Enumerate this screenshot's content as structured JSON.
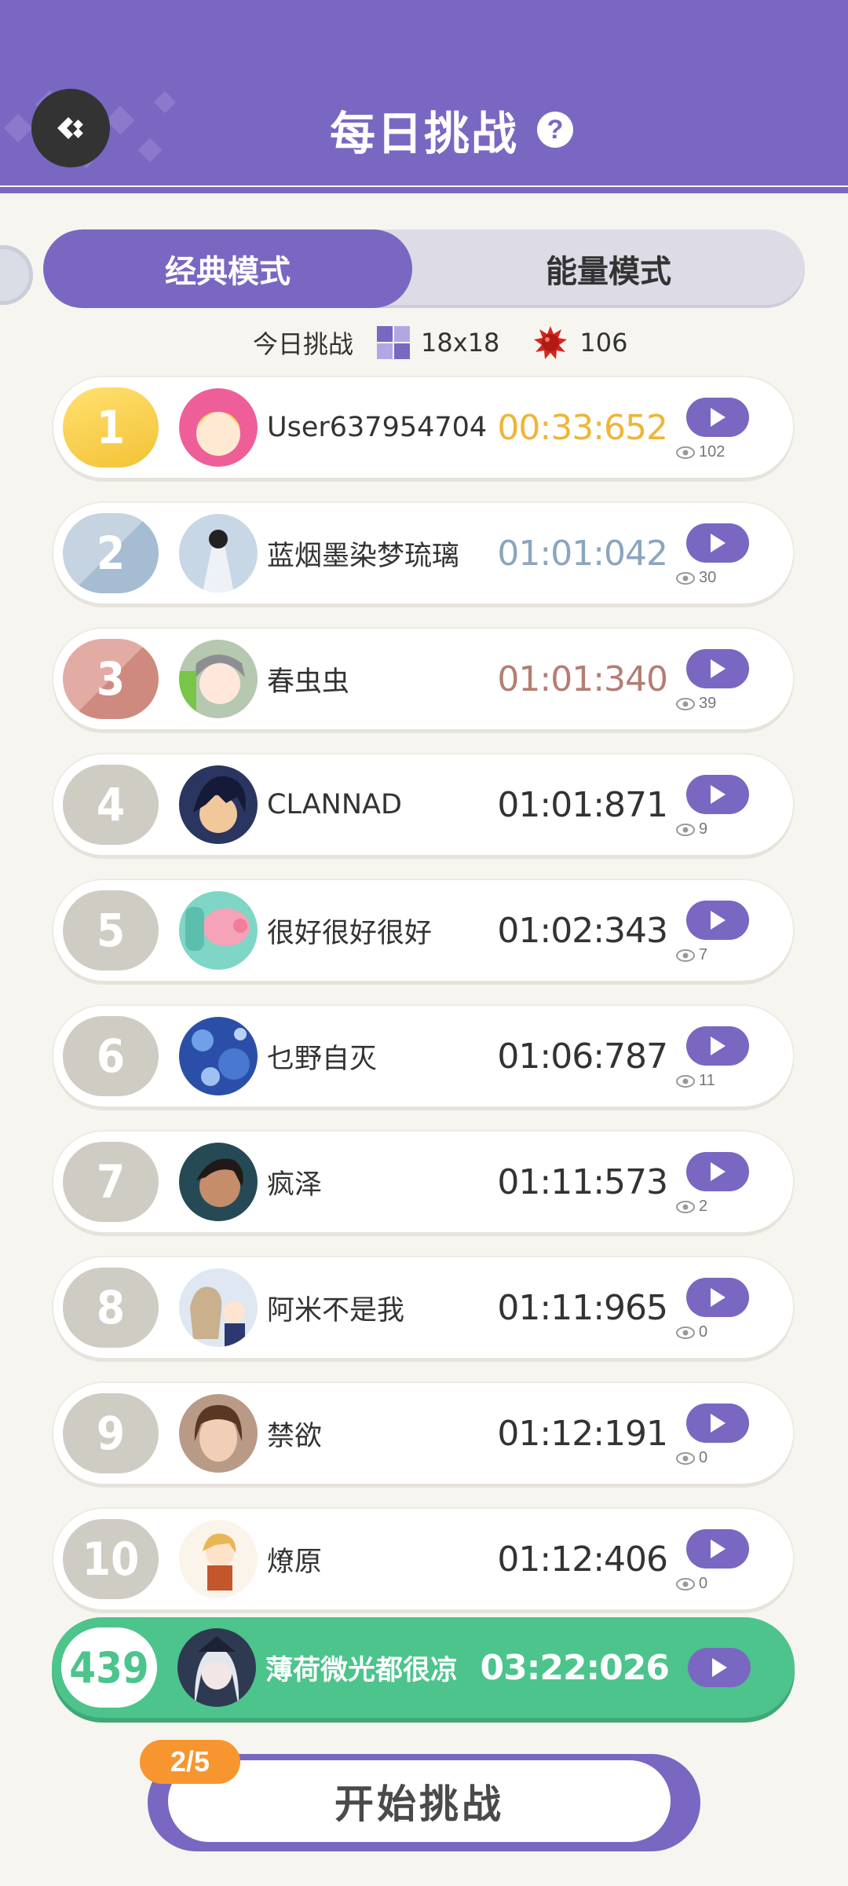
{
  "header": {
    "title": "每日挑战",
    "help_symbol": "?"
  },
  "tabs": [
    {
      "label": "经典模式",
      "active": true
    },
    {
      "label": "能量模式",
      "active": false
    }
  ],
  "info": {
    "today_label": "今日挑战",
    "grid_size": "18x18",
    "mine_count": "106"
  },
  "leaderboard": [
    {
      "rank": "1",
      "name": "User637954704",
      "time": "00:33:652",
      "views": "102",
      "tier": "gold"
    },
    {
      "rank": "2",
      "name": "蓝烟墨染梦琉璃",
      "time": "01:01:042",
      "views": "30",
      "tier": "silver"
    },
    {
      "rank": "3",
      "name": "春虫虫",
      "time": "01:01:340",
      "views": "39",
      "tier": "bronze"
    },
    {
      "rank": "4",
      "name": "CLANNAD",
      "time": "01:01:871",
      "views": "9",
      "tier": "normal"
    },
    {
      "rank": "5",
      "name": "很好很好很好",
      "time": "01:02:343",
      "views": "7",
      "tier": "normal"
    },
    {
      "rank": "6",
      "name": "乜野自灭",
      "time": "01:06:787",
      "views": "11",
      "tier": "normal"
    },
    {
      "rank": "7",
      "name": "疯泽",
      "time": "01:11:573",
      "views": "2",
      "tier": "normal"
    },
    {
      "rank": "8",
      "name": "阿米不是我",
      "time": "01:11:965",
      "views": "0",
      "tier": "normal"
    },
    {
      "rank": "9",
      "name": "禁欲",
      "time": "01:12:191",
      "views": "0",
      "tier": "normal"
    },
    {
      "rank": "10",
      "name": "燎原",
      "time": "01:12:406",
      "views": "0",
      "tier": "normal"
    }
  ],
  "my_entry": {
    "rank": "439",
    "name": "薄荷微光都很凉",
    "time": "03:22:026"
  },
  "start": {
    "label": "开始挑战",
    "attempts": "2/5"
  },
  "colors": {
    "primary": "#7a67c1",
    "gold": "#efb536",
    "silver": "#8aa5bf",
    "bronze": "#b57d73",
    "my_row": "#4cc48c",
    "attempt_badge": "#f7962e"
  }
}
